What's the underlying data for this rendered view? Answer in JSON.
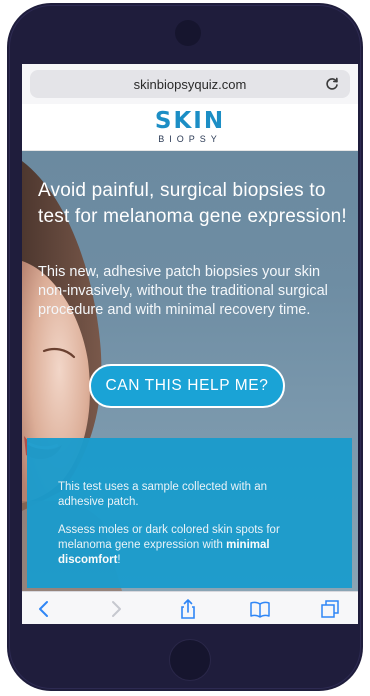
{
  "browser": {
    "url": "skinbiopsyquiz.com"
  },
  "logo": {
    "main": "SKIN",
    "sub": "BIOPSY"
  },
  "hero": {
    "headline": "Avoid painful, surgical biopsies to test for melanoma gene expression!",
    "subhead": "This new, adhesive patch biopsies your skin non-invasively, without the traditional surgical procedure and with minimal recovery time.",
    "cta_label": "CAN THIS HELP ME?"
  },
  "info": {
    "p1": "This test uses a sample collected with an adhesive patch.",
    "p2_start": "Assess moles or dark colored skin spots for melanoma gene expression with ",
    "p2_bold": "minimal discomfort",
    "p2_end": "!"
  },
  "toolbar": {
    "icons": [
      "back-icon",
      "forward-icon",
      "share-icon",
      "bookmarks-icon",
      "tabs-icon"
    ]
  },
  "colors": {
    "brand": "#1c8ec5",
    "cta": "#1aa3d6",
    "info_box": "#1b9ccd",
    "toolbar_icon": "#2f86f6",
    "phone_body": "#1f1d3c"
  }
}
